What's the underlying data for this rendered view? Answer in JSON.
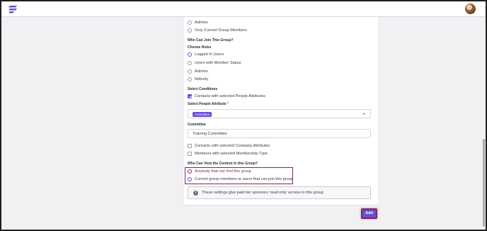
{
  "header": {
    "logo_icon": "brand-logo-icon",
    "avatar_icon": "user-avatar",
    "accent_color": "#6b4fd0"
  },
  "visibility_options": [
    {
      "label": "Admins",
      "selected": false
    },
    {
      "label": "Only Current Group Members",
      "selected": false
    }
  ],
  "join": {
    "heading": "Who Can Join This Group?",
    "roles_label": "Choose Roles",
    "roles": [
      {
        "label": "Logged In Users",
        "selected": true
      },
      {
        "label": "Users with Member Status",
        "selected": false
      },
      {
        "label": "Admins",
        "selected": false
      },
      {
        "label": "Nobody",
        "selected": false
      }
    ],
    "conditions_label": "Select Conditions",
    "condition_people": {
      "label": "Contacts with selected People Attributes",
      "checked": true
    },
    "people_attribute_label": "Select People Attribute",
    "required_mark": "*",
    "people_attribute_tag": "Committee",
    "committee_label": "Committee",
    "committee_value": "Training Committee",
    "condition_company": {
      "label": "Contacts with selected Company Attributes",
      "checked": false
    },
    "condition_membership": {
      "label": "Members with selected Membership Type",
      "checked": false
    }
  },
  "view": {
    "heading": "Who Can View the Content in this Group?",
    "options": [
      {
        "label": "Anybody that can find this group",
        "selected": false
      },
      {
        "label": "Current group members or users that can join this group",
        "selected": true
      }
    ]
  },
  "info": {
    "icon": "info-icon",
    "text": "These settings give paid tier sponsors 'read only' access to this group"
  },
  "actions": {
    "add_label": "Add"
  }
}
